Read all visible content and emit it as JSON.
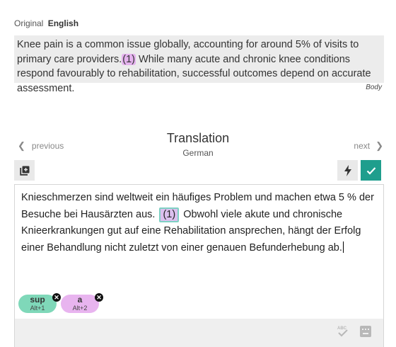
{
  "original": {
    "label": "Original",
    "language": "English",
    "text_before": "Knee pain is a common issue globally, accounting for around 5% of visits to primary care providers.",
    "tag": "(1)",
    "text_after": " While many acute and chronic knee conditions respond favourably to rehabilitation, successful outcomes depend on accurate assessment.",
    "section": "Body"
  },
  "nav": {
    "previous": "previous",
    "next": "next"
  },
  "translation": {
    "title": "Translation",
    "language": "German",
    "text_before": "Knieschmerzen sind weltweit ein häufiges Problem und machen etwa 5 % der Besuche bei Hausärzten aus.",
    "tag": "(1)",
    "text_after": "Obwohl viele akute und chronische Knieerkrankungen gut auf eine Rehabilitation ansprechen, hängt der Erfolg einer Behandlung nicht zuletzt von einer genauen Befunderhebung ab."
  },
  "chips": [
    {
      "name": "sup",
      "shortcut": "Alt+1",
      "color": "#7fd8b9"
    },
    {
      "name": "a",
      "shortcut": "Alt+2",
      "color": "#e8b4ef"
    }
  ],
  "footer": {
    "spell_icon_label": "ABC"
  },
  "colors": {
    "accent": "#1f9e8d",
    "tag_original": "#e5b3ee",
    "tag_translation": "#dcc0ee",
    "tag_border": "#7fd0c4"
  },
  "icons": {
    "copy": "copy-source-icon",
    "bolt": "lightning-icon",
    "check": "check-icon",
    "spell": "spellcheck-icon",
    "keyboard": "keyboard-icon"
  }
}
